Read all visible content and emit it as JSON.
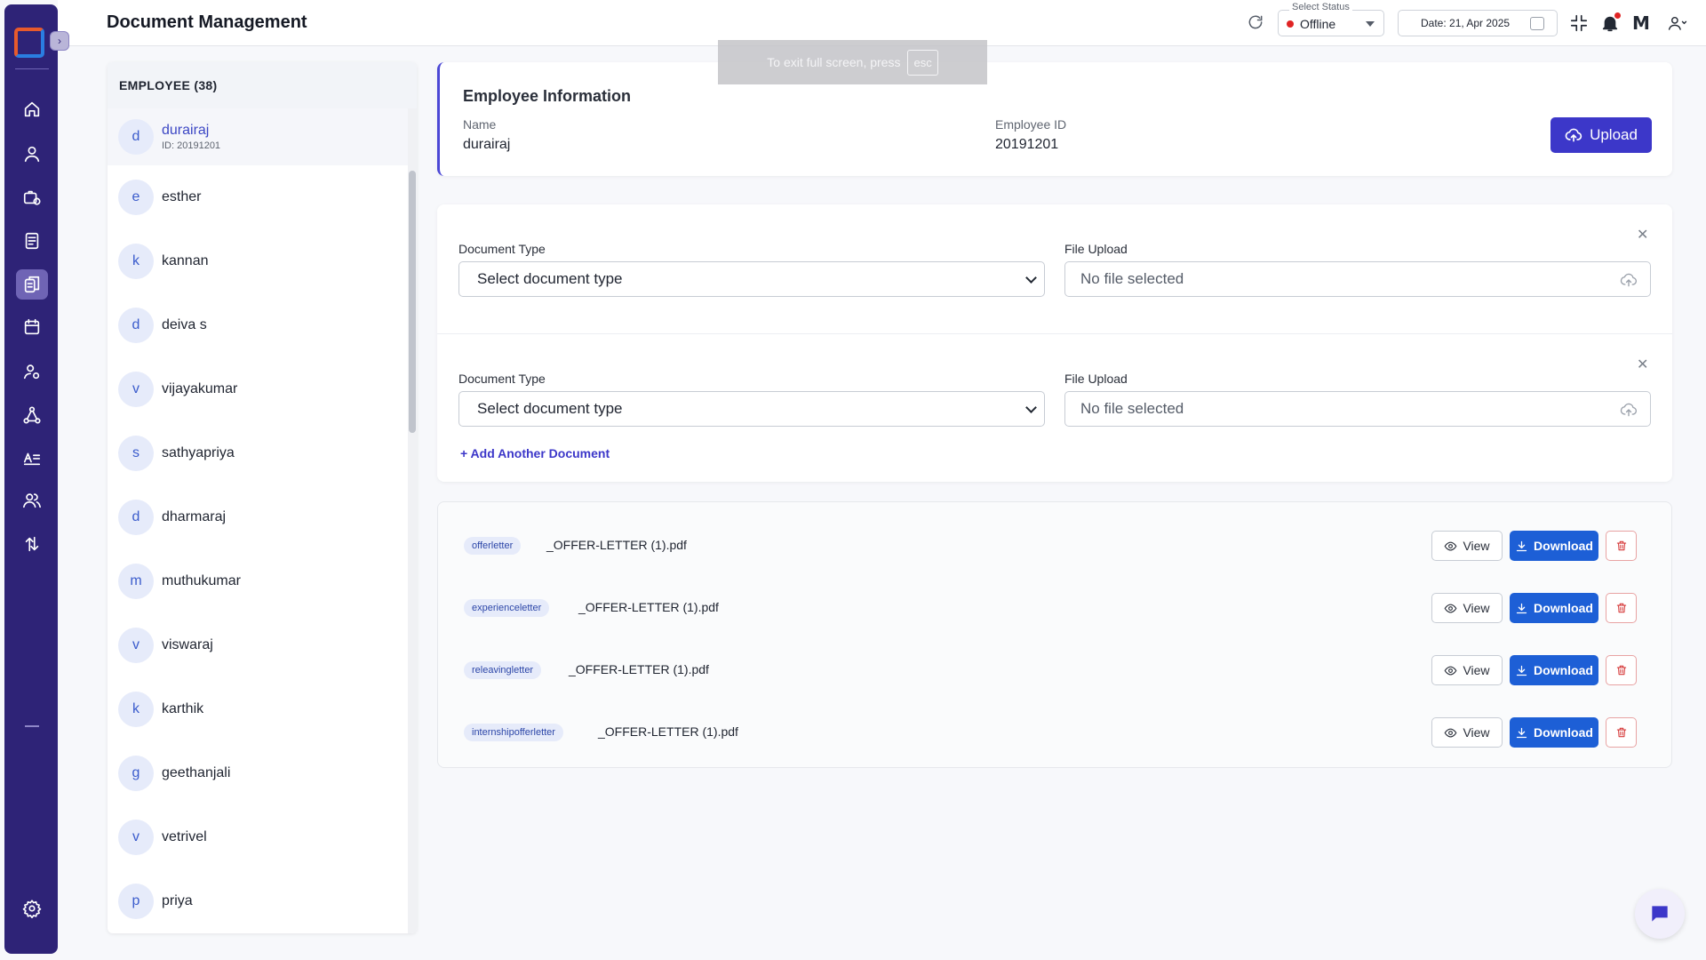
{
  "header": {
    "title": "Document Management",
    "status_legend": "Select Status",
    "status_value": "Offline",
    "date_label": "Date: 21, Apr 2025"
  },
  "toast": {
    "text": "To exit full screen, press",
    "key": "esc"
  },
  "employees": {
    "heading": "EMPLOYEE (38)",
    "items": [
      {
        "initial": "d",
        "name": "durairaj",
        "id": "ID: 20191201"
      },
      {
        "initial": "e",
        "name": "esther"
      },
      {
        "initial": "k",
        "name": "kannan"
      },
      {
        "initial": "d",
        "name": "deiva s"
      },
      {
        "initial": "v",
        "name": "vijayakumar"
      },
      {
        "initial": "s",
        "name": "sathyapriya"
      },
      {
        "initial": "d",
        "name": "dharmaraj"
      },
      {
        "initial": "m",
        "name": "muthukumar"
      },
      {
        "initial": "v",
        "name": "viswaraj"
      },
      {
        "initial": "k",
        "name": "karthik"
      },
      {
        "initial": "g",
        "name": "geethanjali"
      },
      {
        "initial": "v",
        "name": "vetrivel"
      },
      {
        "initial": "p",
        "name": "priya"
      }
    ]
  },
  "info": {
    "title": "Employee Information",
    "name_label": "Name",
    "name_value": "durairaj",
    "id_label": "Employee ID",
    "id_value": "20191201",
    "upload_label": "Upload"
  },
  "form": {
    "rows": [
      {
        "type_label": "Document Type",
        "type_value": "Select document type",
        "file_label": "File Upload",
        "file_value": "No file selected"
      },
      {
        "type_label": "Document Type",
        "type_value": "Select document type",
        "file_label": "File Upload",
        "file_value": "No file selected"
      }
    ],
    "add_label": "+  Add Another Document"
  },
  "documents": {
    "view_label": "View",
    "download_label": "Download",
    "items": [
      {
        "tag": "offerletter",
        "file": "_OFFER-LETTER (1).pdf"
      },
      {
        "tag": "experienceletter",
        "file": "_OFFER-LETTER (1).pdf"
      },
      {
        "tag": "releavingletter",
        "file": "_OFFER-LETTER (1).pdf"
      },
      {
        "tag": "internshipofferletter",
        "file": "_OFFER-LETTER (1).pdf"
      }
    ]
  },
  "icons": {
    "sidebar": [
      "home-icon",
      "user-icon",
      "briefcase-clock-icon",
      "document-icon",
      "documents-icon",
      "calendar-icon",
      "user-settings-icon",
      "network-icon",
      "text-list-icon",
      "users-icon",
      "transfer-icon",
      "settings-icon"
    ]
  },
  "colors": {
    "sidebar": "#2e2377",
    "primary": "#3c37c9",
    "download": "#1d5fd6",
    "status_offline": "#e02424"
  }
}
